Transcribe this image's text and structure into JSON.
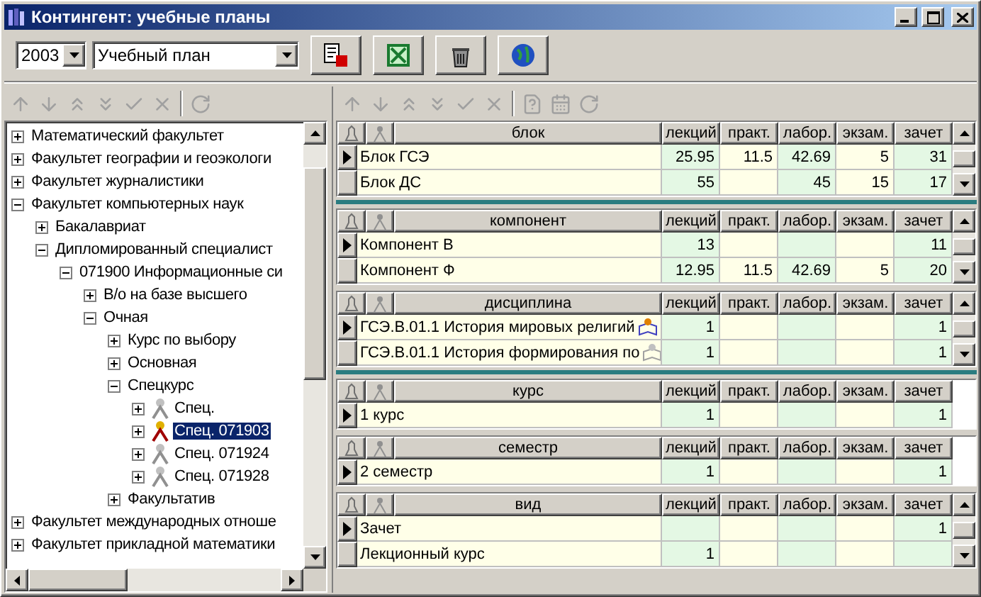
{
  "window": {
    "title": "Контингент: учебные планы"
  },
  "toolbar": {
    "year": "2003",
    "plan": "Учебный план"
  },
  "tree": [
    {
      "label": "Математический факультет",
      "expanded": false,
      "selected": false
    },
    {
      "label": "Факультет географии и геоэкологи",
      "expanded": false,
      "selected": false
    },
    {
      "label": "Факультет журналистики",
      "expanded": false,
      "selected": false
    },
    {
      "label": "Факультет компьютерных наук",
      "expanded": true,
      "selected": false,
      "children": [
        {
          "label": "Бакалавриат",
          "expanded": false,
          "selected": false
        },
        {
          "label": "Дипломированный специалист",
          "expanded": true,
          "selected": false,
          "children": [
            {
              "label": "071900 Информационные си",
              "expanded": true,
              "selected": false,
              "children": [
                {
                  "label": "В/о на базе высшего",
                  "expanded": false,
                  "selected": false
                },
                {
                  "label": "Очная",
                  "expanded": true,
                  "selected": false,
                  "children": [
                    {
                      "label": "Курс по выбору",
                      "expanded": false,
                      "selected": false
                    },
                    {
                      "label": "Основная",
                      "expanded": false,
                      "selected": false
                    },
                    {
                      "label": "Спецкурс",
                      "expanded": true,
                      "selected": false,
                      "children": [
                        {
                          "label": "Спец.",
                          "expanded": false,
                          "selected": false,
                          "kind": "spec"
                        },
                        {
                          "label": "Спец. 071903",
                          "expanded": false,
                          "selected": true,
                          "kind": "spec-active"
                        },
                        {
                          "label": "Спец. 071924",
                          "expanded": false,
                          "selected": false,
                          "kind": "spec"
                        },
                        {
                          "label": "Спец. 071928",
                          "expanded": false,
                          "selected": false,
                          "kind": "spec"
                        }
                      ]
                    },
                    {
                      "label": "Факультатив",
                      "expanded": false,
                      "selected": false
                    }
                  ]
                }
              ]
            }
          ]
        }
      ]
    },
    {
      "label": "Факультет международных отноше",
      "expanded": false,
      "selected": false
    },
    {
      "label": "Факультет прикладной математики",
      "expanded": false,
      "selected": false
    }
  ],
  "grids": [
    {
      "header": "блок",
      "columns": [
        "лекций",
        "практ.",
        "лабор.",
        "экзам.",
        "зачет"
      ],
      "scrollable": true,
      "separator_below": true,
      "rows": [
        {
          "name": "Блок ГСЭ",
          "current": true,
          "values": {
            "lectures": "25.95",
            "practice": "11.5",
            "labs": "42.69",
            "exams": "5",
            "credits": "31"
          }
        },
        {
          "name": "Блок ДС",
          "current": false,
          "values": {
            "lectures": "55",
            "labs": "45",
            "exams": "15",
            "credits": "17"
          }
        }
      ]
    },
    {
      "header": "компонент",
      "columns": [
        "лекций",
        "практ.",
        "лабор.",
        "экзам.",
        "зачет"
      ],
      "scrollable": true,
      "separator_below": false,
      "rows": [
        {
          "name": "Компонент В",
          "current": true,
          "values": {
            "lectures": "13",
            "credits": "11"
          }
        },
        {
          "name": "Компонент Ф",
          "current": false,
          "values": {
            "lectures": "12.95",
            "practice": "11.5",
            "labs": "42.69",
            "exams": "5",
            "credits": "20"
          }
        }
      ]
    },
    {
      "header": "дисциплина",
      "columns": [
        "лекций",
        "практ.",
        "лабор.",
        "экзам.",
        "зачет"
      ],
      "scrollable": true,
      "separator_below": true,
      "rows": [
        {
          "name": "ГСЭ.В.01.1 История мировых религий",
          "current": true,
          "marked": true,
          "values": {
            "lectures": "1",
            "credits": "1"
          }
        },
        {
          "name": "ГСЭ.В.01.1 История формирования по",
          "current": false,
          "marked": false,
          "values": {
            "lectures": "1",
            "credits": "1"
          }
        }
      ]
    },
    {
      "header": "курс",
      "columns": [
        "лекций",
        "практ.",
        "лабор.",
        "экзам.",
        "зачет"
      ],
      "scrollable": false,
      "separator_below": false,
      "rows": [
        {
          "name": "1 курс",
          "current": true,
          "values": {
            "lectures": "1",
            "credits": "1"
          }
        }
      ]
    },
    {
      "header": "семестр",
      "columns": [
        "лекций",
        "практ.",
        "лабор.",
        "экзам.",
        "зачет"
      ],
      "scrollable": false,
      "separator_below": false,
      "rows": [
        {
          "name": "2 семестр",
          "current": true,
          "values": {
            "lectures": "1",
            "credits": "1"
          }
        }
      ]
    },
    {
      "header": "вид",
      "columns": [
        "лекций",
        "практ.",
        "лабор.",
        "экзам.",
        "зачет"
      ],
      "scrollable": true,
      "separator_below": false,
      "rows": [
        {
          "name": "Зачет",
          "current": true,
          "values": {
            "credits": "1"
          }
        },
        {
          "name": "Лекционный курс",
          "current": false,
          "values": {
            "lectures": "1"
          }
        }
      ]
    }
  ]
}
